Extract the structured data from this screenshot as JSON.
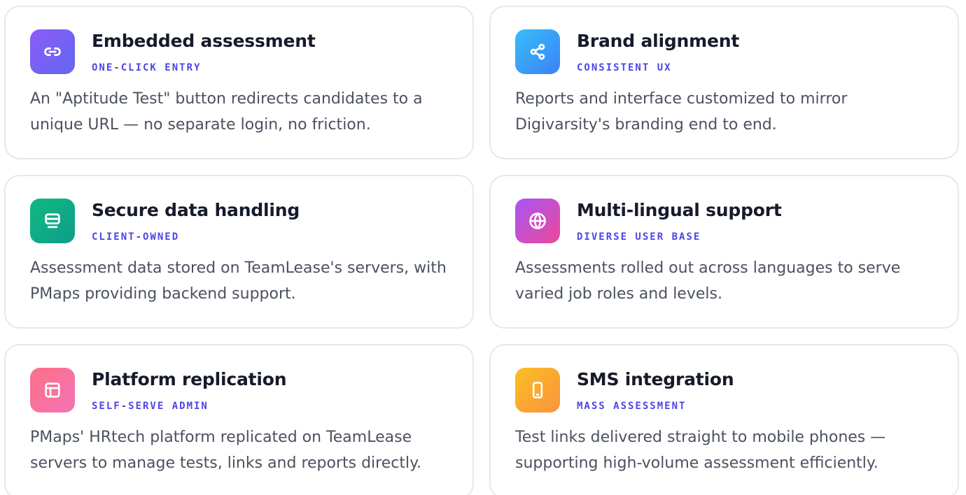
{
  "cards": [
    {
      "title": "Embedded assessment",
      "subtitle": "ONE-CLICK ENTRY",
      "desc": "An \"Aptitude Test\" button redirects candidates to a unique URL — no separate login, no friction.",
      "icon": "link-icon",
      "gradient": [
        "#8b5cf6",
        "#6366f1"
      ]
    },
    {
      "title": "Brand alignment",
      "subtitle": "CONSISTENT UX",
      "desc": "Reports and interface customized to mirror Digivarsity's branding end to end.",
      "icon": "share-icon",
      "gradient": [
        "#38bdf8",
        "#3b82f6"
      ]
    },
    {
      "title": "Secure data handling",
      "subtitle": "CLIENT-OWNED",
      "desc": "Assessment data stored on TeamLease's servers, with PMaps providing backend support.",
      "icon": "server-icon",
      "gradient": [
        "#10b981",
        "#0f9d8a"
      ]
    },
    {
      "title": "Multi-lingual support",
      "subtitle": "DIVERSE USER BASE",
      "desc": "Assessments rolled out across languages to serve varied job roles and levels.",
      "icon": "globe-icon",
      "gradient": [
        "#a855f7",
        "#ec4899"
      ]
    },
    {
      "title": "Platform replication",
      "subtitle": "SELF-SERVE ADMIN",
      "desc": "PMaps' HRtech platform replicated on TeamLease servers to manage tests, links and reports directly.",
      "icon": "layout-icon",
      "gradient": [
        "#fb7185",
        "#f472b6"
      ]
    },
    {
      "title": "SMS integration",
      "subtitle": "MASS ASSESSMENT",
      "desc": "Test links delivered straight to mobile phones — supporting high-volume assessment efficiently.",
      "icon": "phone-icon",
      "gradient": [
        "#fbbf24",
        "#fb923c"
      ]
    }
  ]
}
